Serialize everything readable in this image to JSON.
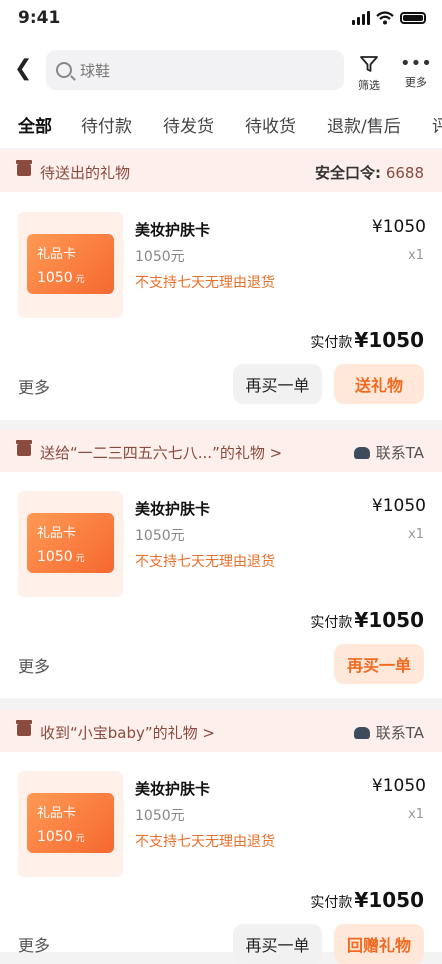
{
  "status_bar": {
    "time": "9:41"
  },
  "search": {
    "placeholder": "球鞋"
  },
  "toolbar": {
    "filter_label": "筛选",
    "more_label": "更多"
  },
  "tabs": [
    "全部",
    "待付款",
    "待发货",
    "待收货",
    "退款/售后",
    "评"
  ],
  "orders": [
    {
      "header_title": "待送出的礼物",
      "header_right_label": "安全口令:",
      "header_right_code": "6688",
      "product": {
        "card_label": "礼品卡",
        "card_amount": "1050",
        "card_unit": "元",
        "name": "美妆护肤卡",
        "spec": "1050元",
        "note": "不支持七天无理由退货",
        "price": "¥1050",
        "qty": "x1"
      },
      "paid_label": "实付款",
      "paid_amount": "¥1050",
      "more": "更多",
      "btn_secondary": "再买一单",
      "btn_primary": "送礼物"
    },
    {
      "header_title": "送给“一二三四五六七八...”的礼物 >",
      "contact_label": "联系TA",
      "product": {
        "card_label": "礼品卡",
        "card_amount": "1050",
        "card_unit": "元",
        "name": "美妆护肤卡",
        "spec": "1050元",
        "note": "不支持七天无理由退货",
        "price": "¥1050",
        "qty": "x1"
      },
      "paid_label": "实付款",
      "paid_amount": "¥1050",
      "more": "更多",
      "btn_primary": "再买一单"
    },
    {
      "header_title": "收到“小宝baby”的礼物 >",
      "contact_label": "联系TA",
      "product": {
        "card_label": "礼品卡",
        "card_amount": "1050",
        "card_unit": "元",
        "name": "美妆护肤卡",
        "spec": "1050元",
        "note": "不支持七天无理由退货",
        "price": "¥1050",
        "qty": "x1"
      },
      "paid_label": "实付款",
      "paid_amount": "¥1050",
      "more": "更多",
      "btn_secondary": "再买一单",
      "btn_primary": "回赠礼物"
    }
  ],
  "colors": {
    "accent": "#f26a20",
    "header_bg": "#fdf0ec",
    "header_text": "#8a4a3e"
  }
}
